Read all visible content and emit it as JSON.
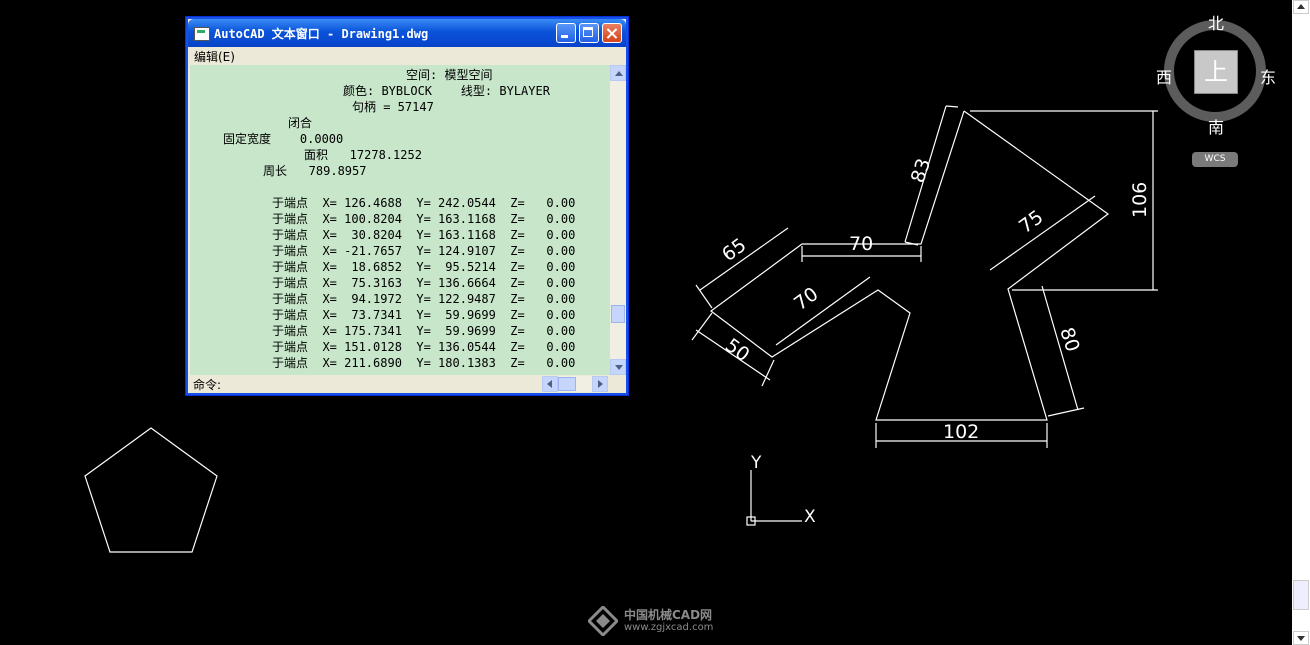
{
  "text_window": {
    "title": "AutoCAD 文本窗口 - Drawing1.dwg",
    "menu_edit": "编辑(E)",
    "lines": [
      "空间: 模型空间",
      "颜色: BYBLOCK    线型: BYLAYER",
      "句柄 = 57147",
      "闭合",
      "固定宽度    0.0000",
      "面积   17278.1252",
      "周长   789.8957"
    ],
    "points": [
      "于端点  X= 126.4688  Y= 242.0544  Z=   0.00",
      "于端点  X= 100.8204  Y= 163.1168  Z=   0.00",
      "于端点  X=  30.8204  Y= 163.1168  Z=   0.00",
      "于端点  X= -21.7657  Y= 124.9107  Z=   0.00",
      "于端点  X=  18.6852  Y=  95.5214  Z=   0.00",
      "于端点  X=  75.3163  Y= 136.6664  Z=   0.00",
      "于端点  X=  94.1972  Y= 122.9487  Z=   0.00",
      "于端点  X=  73.7341  Y=  59.9699  Z=   0.00",
      "于端点  X= 175.7341  Y=  59.9699  Z=   0.00",
      "于端点  X= 151.0128  Y= 136.0544  Z=   0.00",
      "于端点  X= 211.6890  Y= 180.1383  Z=   0.00"
    ],
    "command_label": "命令:"
  },
  "dimensions": {
    "d83": "83",
    "d106": "106",
    "d75": "75",
    "d65": "65",
    "d70a": "70",
    "d70b": "70",
    "d50": "50",
    "d80": "80",
    "d102": "102"
  },
  "ucs": {
    "x_label": "X",
    "y_label": "Y"
  },
  "viewcube": {
    "north": "北",
    "south": "南",
    "west": "西",
    "east": "东",
    "face": "上",
    "wcs": "WCS"
  },
  "watermark": {
    "line1": "中国机械CAD网",
    "line2": "www.zgjxcad.com"
  },
  "colors": {
    "background": "#000000",
    "text_area": "#c8e6ca",
    "title_bar": "#0a53d9"
  }
}
